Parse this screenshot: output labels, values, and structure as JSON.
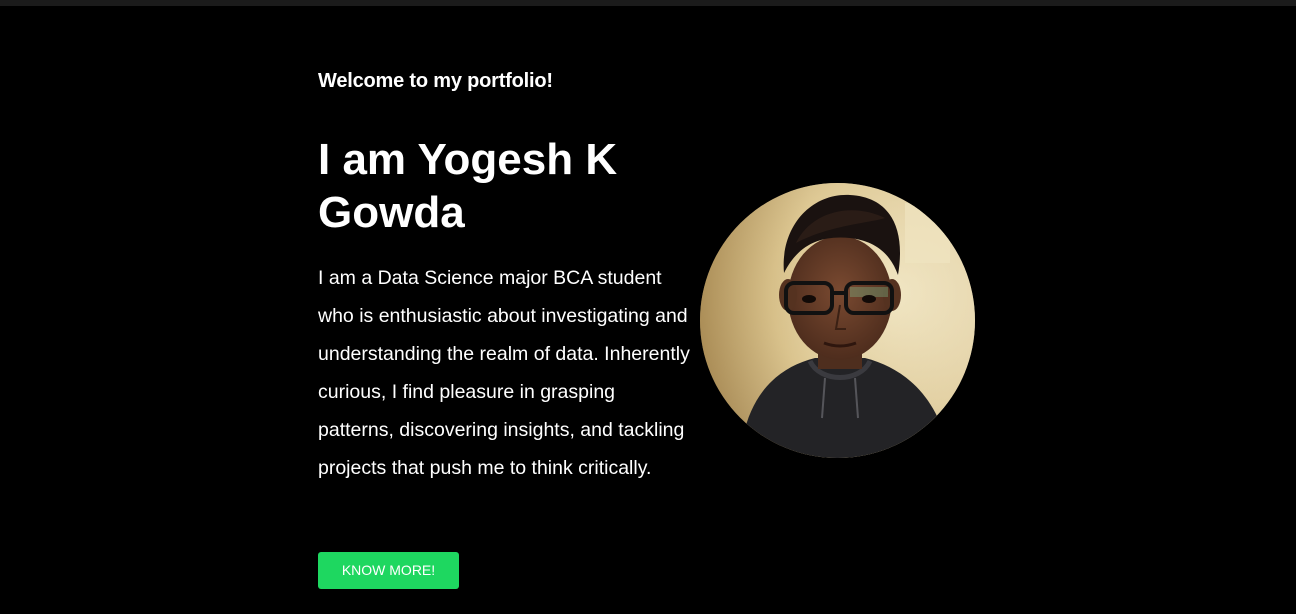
{
  "hero": {
    "greeting": "Welcome to my portfolio!",
    "title": "I am Yogesh K Gowda",
    "bio": "I am a Data Science major BCA student who is enthusiastic about investigating and understanding the realm of data. Inherently curious, I find pleasure in grasping patterns, discovering insights, and tackling projects that push me to think critically.",
    "cta_label": "KNOW MORE!"
  },
  "colors": {
    "background": "#000000",
    "text": "#ffffff",
    "accent": "#1ed760"
  }
}
